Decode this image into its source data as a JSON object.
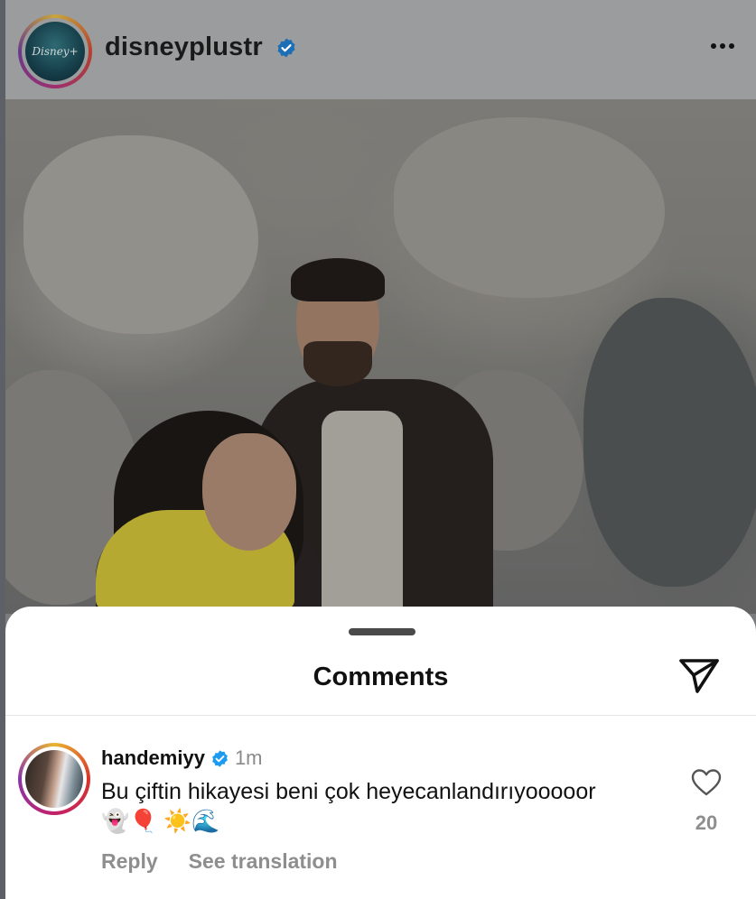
{
  "post": {
    "username": "disneyplustr",
    "avatar_text": "Disney+",
    "verified_icon": "verified-badge-icon",
    "more_icon": "more-horizontal-icon"
  },
  "comments_sheet": {
    "title": "Comments",
    "share_icon": "send-icon"
  },
  "comment": {
    "username": "handemiyy",
    "time": "1m",
    "text": "Bu çiftin hikayesi beni çok heyecanlandırıyooooor 👻🎈 ☀️🌊",
    "reply_label": "Reply",
    "translate_label": "See translation",
    "like_count": "20",
    "like_icon": "heart-outline-icon"
  },
  "colors": {
    "verified_blue": "#1d9bf0",
    "muted_text": "#8e8e8e"
  }
}
